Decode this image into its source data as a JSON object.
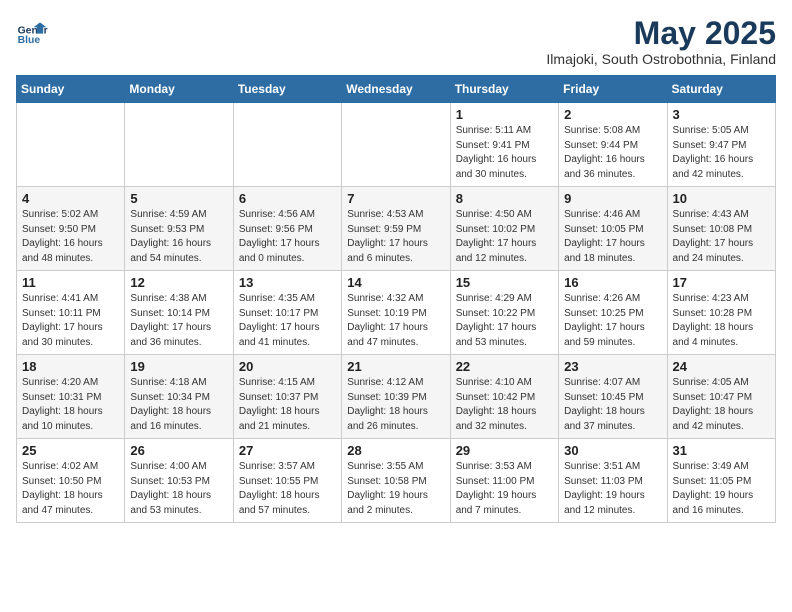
{
  "header": {
    "logo_line1": "General",
    "logo_line2": "Blue",
    "title": "May 2025",
    "subtitle": "Ilmajoki, South Ostrobothnia, Finland"
  },
  "weekdays": [
    "Sunday",
    "Monday",
    "Tuesday",
    "Wednesday",
    "Thursday",
    "Friday",
    "Saturday"
  ],
  "weeks": [
    [
      {
        "day": "",
        "info": ""
      },
      {
        "day": "",
        "info": ""
      },
      {
        "day": "",
        "info": ""
      },
      {
        "day": "",
        "info": ""
      },
      {
        "day": "1",
        "info": "Sunrise: 5:11 AM\nSunset: 9:41 PM\nDaylight: 16 hours\nand 30 minutes."
      },
      {
        "day": "2",
        "info": "Sunrise: 5:08 AM\nSunset: 9:44 PM\nDaylight: 16 hours\nand 36 minutes."
      },
      {
        "day": "3",
        "info": "Sunrise: 5:05 AM\nSunset: 9:47 PM\nDaylight: 16 hours\nand 42 minutes."
      }
    ],
    [
      {
        "day": "4",
        "info": "Sunrise: 5:02 AM\nSunset: 9:50 PM\nDaylight: 16 hours\nand 48 minutes."
      },
      {
        "day": "5",
        "info": "Sunrise: 4:59 AM\nSunset: 9:53 PM\nDaylight: 16 hours\nand 54 minutes."
      },
      {
        "day": "6",
        "info": "Sunrise: 4:56 AM\nSunset: 9:56 PM\nDaylight: 17 hours\nand 0 minutes."
      },
      {
        "day": "7",
        "info": "Sunrise: 4:53 AM\nSunset: 9:59 PM\nDaylight: 17 hours\nand 6 minutes."
      },
      {
        "day": "8",
        "info": "Sunrise: 4:50 AM\nSunset: 10:02 PM\nDaylight: 17 hours\nand 12 minutes."
      },
      {
        "day": "9",
        "info": "Sunrise: 4:46 AM\nSunset: 10:05 PM\nDaylight: 17 hours\nand 18 minutes."
      },
      {
        "day": "10",
        "info": "Sunrise: 4:43 AM\nSunset: 10:08 PM\nDaylight: 17 hours\nand 24 minutes."
      }
    ],
    [
      {
        "day": "11",
        "info": "Sunrise: 4:41 AM\nSunset: 10:11 PM\nDaylight: 17 hours\nand 30 minutes."
      },
      {
        "day": "12",
        "info": "Sunrise: 4:38 AM\nSunset: 10:14 PM\nDaylight: 17 hours\nand 36 minutes."
      },
      {
        "day": "13",
        "info": "Sunrise: 4:35 AM\nSunset: 10:17 PM\nDaylight: 17 hours\nand 41 minutes."
      },
      {
        "day": "14",
        "info": "Sunrise: 4:32 AM\nSunset: 10:19 PM\nDaylight: 17 hours\nand 47 minutes."
      },
      {
        "day": "15",
        "info": "Sunrise: 4:29 AM\nSunset: 10:22 PM\nDaylight: 17 hours\nand 53 minutes."
      },
      {
        "day": "16",
        "info": "Sunrise: 4:26 AM\nSunset: 10:25 PM\nDaylight: 17 hours\nand 59 minutes."
      },
      {
        "day": "17",
        "info": "Sunrise: 4:23 AM\nSunset: 10:28 PM\nDaylight: 18 hours\nand 4 minutes."
      }
    ],
    [
      {
        "day": "18",
        "info": "Sunrise: 4:20 AM\nSunset: 10:31 PM\nDaylight: 18 hours\nand 10 minutes."
      },
      {
        "day": "19",
        "info": "Sunrise: 4:18 AM\nSunset: 10:34 PM\nDaylight: 18 hours\nand 16 minutes."
      },
      {
        "day": "20",
        "info": "Sunrise: 4:15 AM\nSunset: 10:37 PM\nDaylight: 18 hours\nand 21 minutes."
      },
      {
        "day": "21",
        "info": "Sunrise: 4:12 AM\nSunset: 10:39 PM\nDaylight: 18 hours\nand 26 minutes."
      },
      {
        "day": "22",
        "info": "Sunrise: 4:10 AM\nSunset: 10:42 PM\nDaylight: 18 hours\nand 32 minutes."
      },
      {
        "day": "23",
        "info": "Sunrise: 4:07 AM\nSunset: 10:45 PM\nDaylight: 18 hours\nand 37 minutes."
      },
      {
        "day": "24",
        "info": "Sunrise: 4:05 AM\nSunset: 10:47 PM\nDaylight: 18 hours\nand 42 minutes."
      }
    ],
    [
      {
        "day": "25",
        "info": "Sunrise: 4:02 AM\nSunset: 10:50 PM\nDaylight: 18 hours\nand 47 minutes."
      },
      {
        "day": "26",
        "info": "Sunrise: 4:00 AM\nSunset: 10:53 PM\nDaylight: 18 hours\nand 53 minutes."
      },
      {
        "day": "27",
        "info": "Sunrise: 3:57 AM\nSunset: 10:55 PM\nDaylight: 18 hours\nand 57 minutes."
      },
      {
        "day": "28",
        "info": "Sunrise: 3:55 AM\nSunset: 10:58 PM\nDaylight: 19 hours\nand 2 minutes."
      },
      {
        "day": "29",
        "info": "Sunrise: 3:53 AM\nSunset: 11:00 PM\nDaylight: 19 hours\nand 7 minutes."
      },
      {
        "day": "30",
        "info": "Sunrise: 3:51 AM\nSunset: 11:03 PM\nDaylight: 19 hours\nand 12 minutes."
      },
      {
        "day": "31",
        "info": "Sunrise: 3:49 AM\nSunset: 11:05 PM\nDaylight: 19 hours\nand 16 minutes."
      }
    ]
  ]
}
